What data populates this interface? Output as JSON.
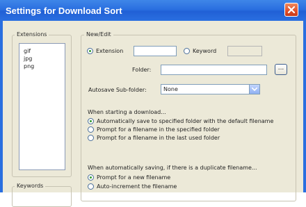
{
  "window": {
    "title": "Settings for Download Sort"
  },
  "extensions": {
    "group_label": "Extensions",
    "items": [
      "gif",
      "jpg",
      "png"
    ]
  },
  "keywords": {
    "group_label": "Keywords"
  },
  "new_edit": {
    "group_label": "New/Edit",
    "extension_label": "Extension",
    "extension_value": "",
    "keyword_label": "Keyword",
    "keyword_value": "",
    "selected_type": "Extension",
    "folder_label": "Folder:",
    "folder_value": "",
    "browse_label": "...",
    "autosave_label": "Autosave Sub-folder:",
    "autosave_value": "None"
  },
  "download_start": {
    "heading": "When starting a download...",
    "options": [
      "Automatically save to specified folder with the default filename",
      "Prompt for a filename in the specified folder",
      "Prompt for a filename in the last used folder"
    ],
    "selected_index": 0
  },
  "duplicate": {
    "heading": "When automatically saving, if there is a duplicate filename...",
    "options": [
      "Prompt for a new filename",
      "Auto-increment the filename"
    ],
    "selected_index": 0
  },
  "colors": {
    "titlebar": "#2a6fe0",
    "dialog_bg": "#ece9d8",
    "close_button": "#e04e2a",
    "radio_dot": "#2f9a2f"
  }
}
